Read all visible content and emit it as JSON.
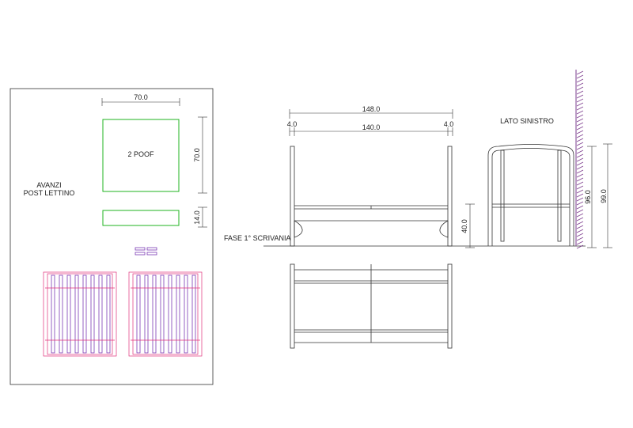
{
  "colors": {
    "line": "#333333",
    "green": "#1fb31f",
    "pink": "#e0307a",
    "purple": "#7a3bb5",
    "hatch": "#7a3b8c"
  },
  "sheet": {
    "poof_width": "70.0",
    "poof_height": "70.0",
    "poof_label": "2 POOF",
    "strip_height": "14.0",
    "avanzi_line1": "AVANZI",
    "avanzi_line2": "POST LETTINO"
  },
  "front": {
    "total_width": "148.0",
    "left_post": "4.0",
    "right_post": "4.0",
    "inner_width": "140.0",
    "desk_height": "40.0",
    "phase_label": "FASE 1° SCRIVANIA"
  },
  "side": {
    "title": "LATO SINISTRO",
    "height_inner": "96.0",
    "height_total": "99.0"
  }
}
